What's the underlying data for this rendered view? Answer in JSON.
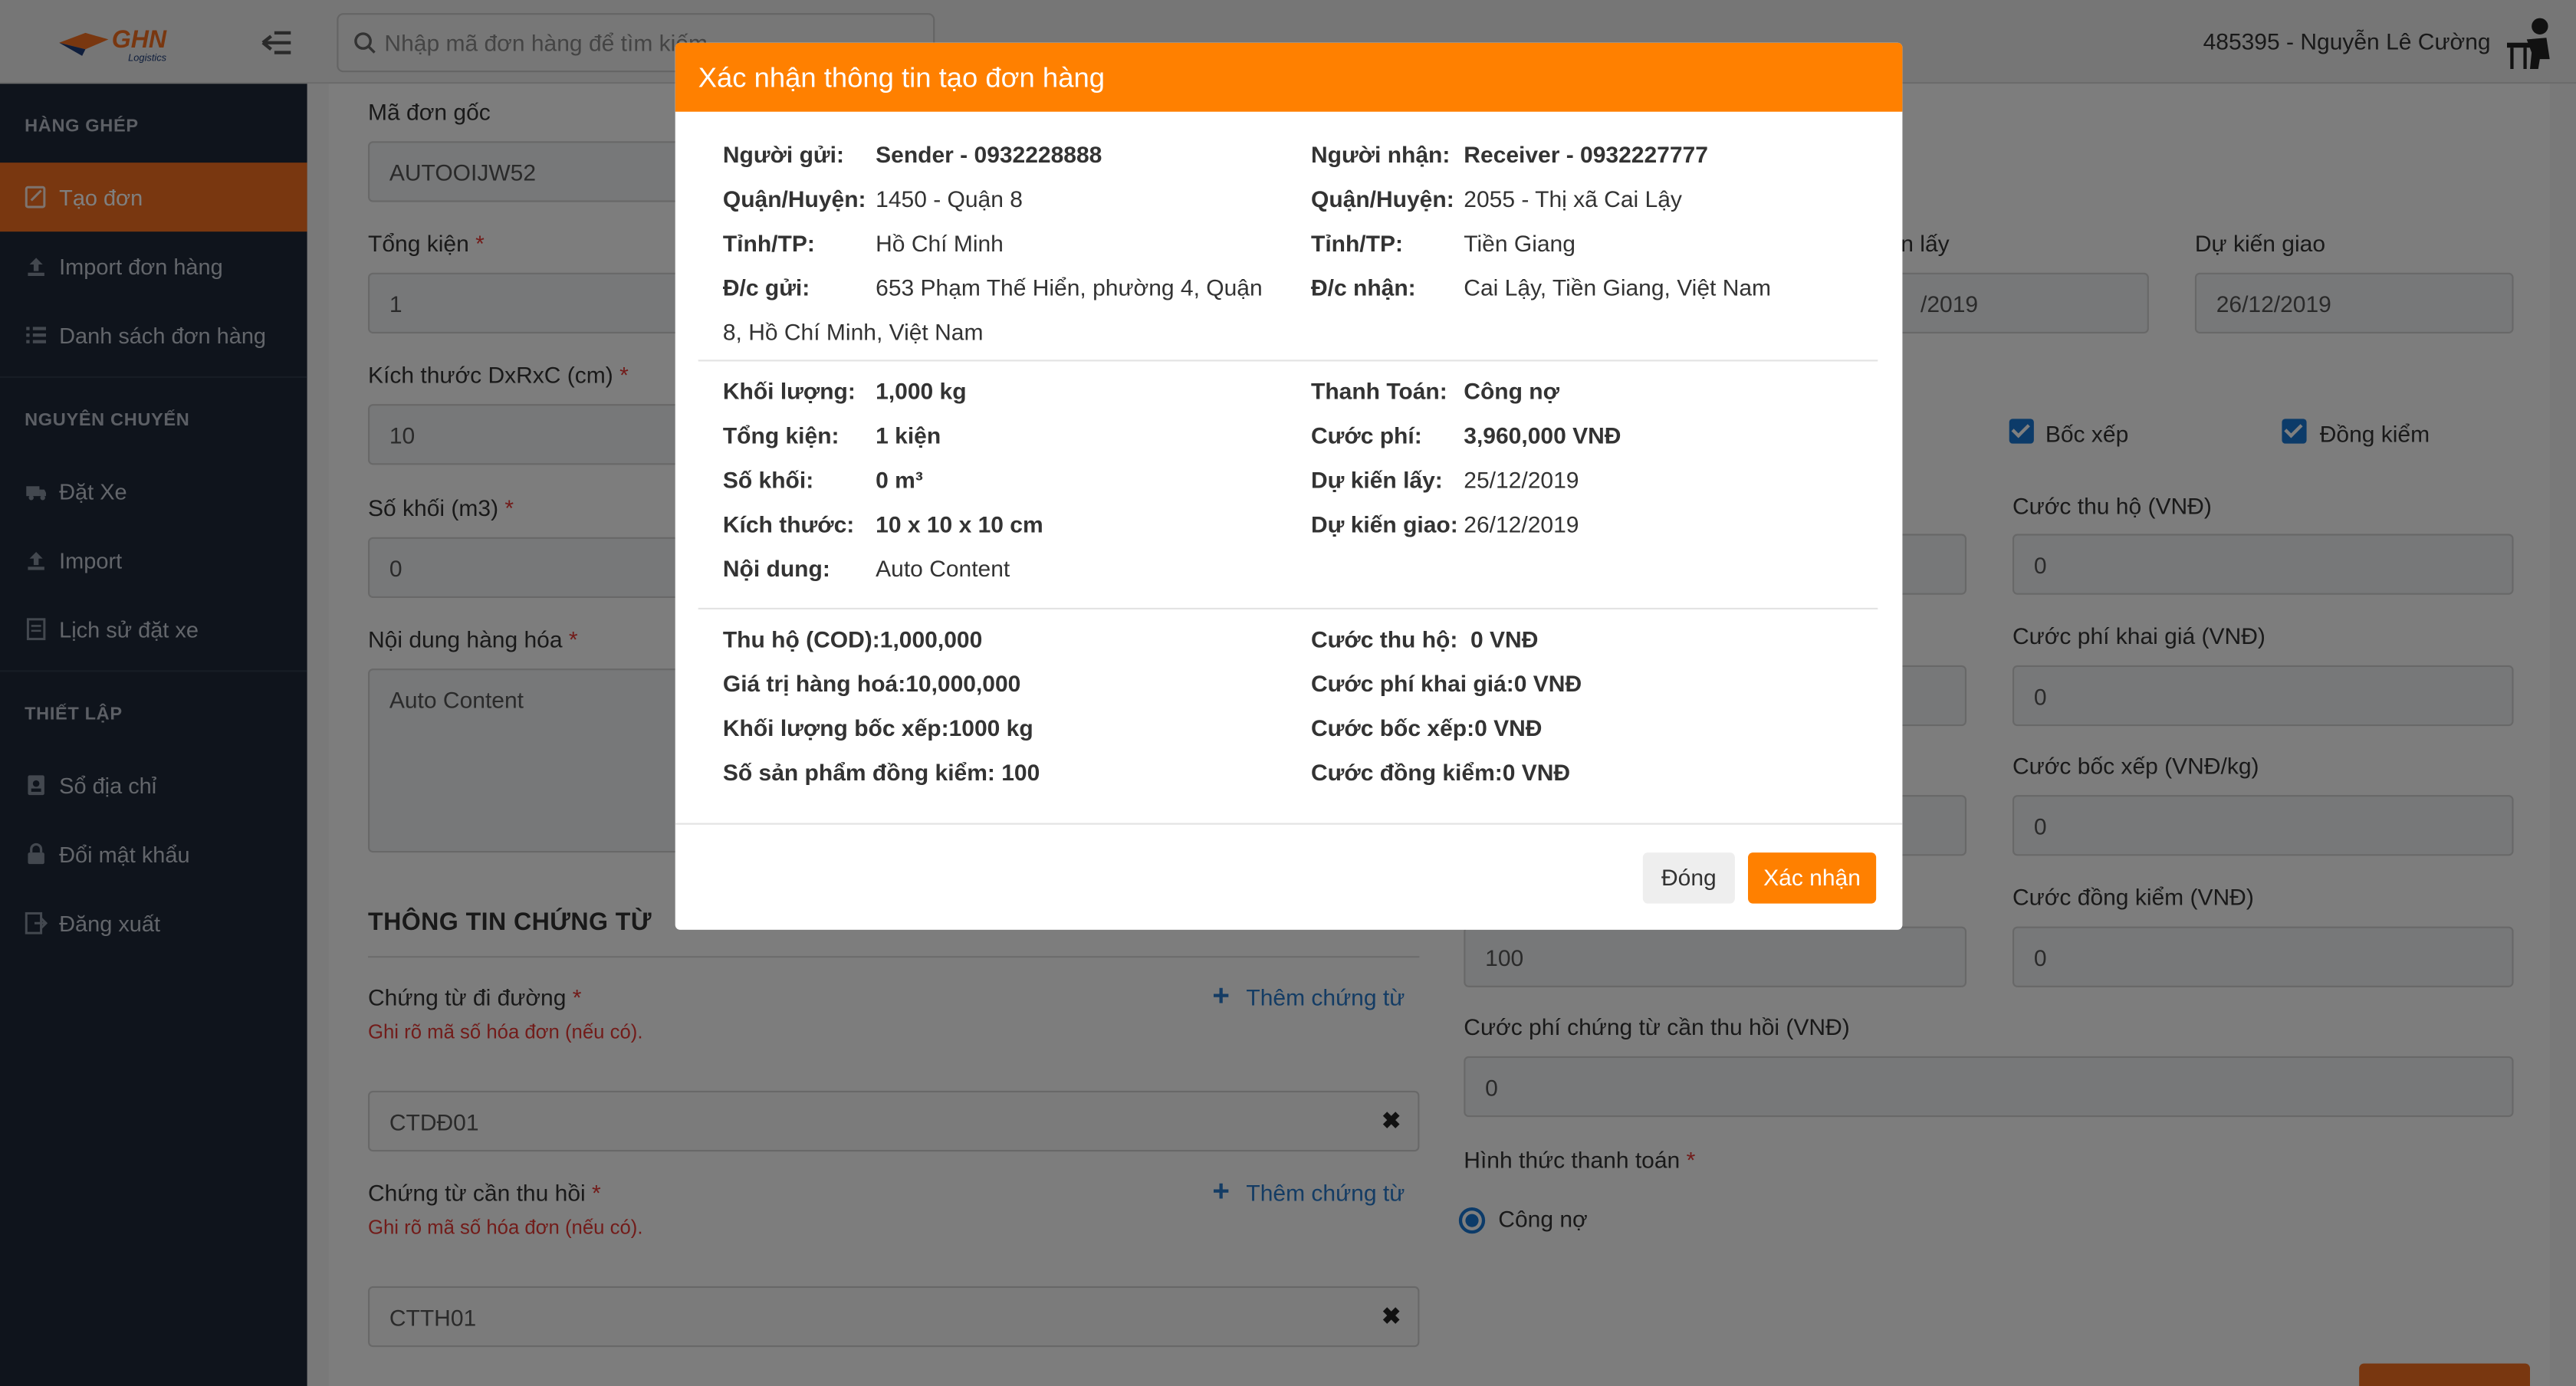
{
  "header": {
    "search_placeholder": "Nhập mã đơn hàng để tìm kiếm",
    "user": "485395 - Nguyễn Lê Cường",
    "logo_text": "GHN Logistics"
  },
  "sidebar": {
    "section1": "HÀNG GHÉP",
    "items1": [
      "Tạo đơn",
      "Import đơn hàng",
      "Danh sách đơn hàng"
    ],
    "section2": "NGUYÊN CHUYẾN",
    "items2": [
      "Đặt Xe",
      "Import",
      "Lịch sử đặt xe"
    ],
    "section3": "THIẾT LẬP",
    "items3": [
      "Sổ địa chỉ",
      "Đổi mật khẩu",
      "Đăng xuất"
    ]
  },
  "form": {
    "ma_don_goc_label": "Mã đơn gốc",
    "ma_don_goc_value": "AUTOOIJW52",
    "tong_kien_label": "Tổng kiện",
    "tong_kien_value": "1",
    "kich_thuoc_label": "Kích thước DxRxC (cm)",
    "kich_thuoc_value": "10",
    "so_khoi_label": "Số khối (m3)",
    "so_khoi_value": "0",
    "noi_dung_label": "Nội dung hàng hóa",
    "noi_dung_value": "Auto Content",
    "du_kien_lay_label": "n lấy",
    "du_kien_lay_value": "/2019",
    "du_kien_giao_label": "Dự kiến giao",
    "du_kien_giao_value": "26/12/2019",
    "boc_xep": "Bốc xếp",
    "dong_kiem": "Đồng kiểm",
    "cuoc_thu_ho_label": "Cước thu hộ (VNĐ)",
    "cuoc_thu_ho_value": "0",
    "cuoc_khai_gia_label": "Cước phí khai giá (VNĐ)",
    "cuoc_khai_gia_value": "0",
    "cuoc_boc_xep_label": "Cước bốc xếp (VNĐ/kg)",
    "cuoc_boc_xep_value": "0",
    "cuoc_dong_kiem_label": "Cước đồng kiểm (VNĐ)",
    "cuoc_dong_kiem_value": "0",
    "dong_kiem_qty_value": "100",
    "cuoc_chung_tu_label": "Cước phí chứng từ cần thu hồi (VNĐ)",
    "cuoc_chung_tu_value": "0",
    "hinh_thuc_label": "Hình thức thanh toán",
    "hinh_thuc_value": "Công nợ",
    "thong_tin_chung_tu": "THÔNG TIN CHỨNG TỪ",
    "chung_tu_di_duong_label": "Chứng từ đi đường",
    "chung_tu_di_duong_hint": "Ghi rõ mã số hóa đơn (nếu có).",
    "chung_tu_di_duong_value": "CTDĐ01",
    "chung_tu_thu_hoi_label": "Chứng từ cần thu hồi",
    "chung_tu_thu_hoi_hint": "Ghi rõ mã số hóa đơn (nếu có).",
    "chung_tu_thu_hoi_value": "CTTH01",
    "them_chung_tu": "Thêm chứng từ",
    "required_mark": "*",
    "remove_mark": "✖",
    "add_mark": "+"
  },
  "modal": {
    "title": "Xác nhận thông tin tạo đơn hàng",
    "nguoi_gui_k": "Người gửi:",
    "nguoi_gui_v": "Sender - 0932228888",
    "quan_gui_k": "Quận/Huyện:",
    "quan_gui_v": "1450 - Quận 8",
    "tinh_gui_k": "Tỉnh/TP:",
    "tinh_gui_v": "Hồ Chí Minh",
    "dc_gui_k": "Đ/c gửi:",
    "dc_gui_v1": "653 Phạm Thế Hiển, phường 4, Quận",
    "dc_gui_v2": "8, Hồ Chí Minh, Việt Nam",
    "nguoi_nhan_k": "Người nhận:",
    "nguoi_nhan_v": "Receiver - 0932227777",
    "quan_nhan_k": "Quận/Huyện:",
    "quan_nhan_v": "2055 - Thị xã Cai Lậy",
    "tinh_nhan_k": "Tỉnh/TP:",
    "tinh_nhan_v": "Tiền Giang",
    "dc_nhan_k": "Đ/c nhận:",
    "dc_nhan_v": "Cai Lậy, Tiền Giang, Việt Nam",
    "khoi_luong_k": "Khối lượng:",
    "khoi_luong_v": "1,000 kg",
    "tong_kien_k": "Tổng kiện:",
    "tong_kien_v": "1 kiện",
    "so_khoi_k": "Số khối:",
    "so_khoi_v": "0 m³",
    "kich_thuoc_k": "Kích thước:",
    "kich_thuoc_v": "10 x 10 x 10 cm",
    "noi_dung_k": "Nội dung:",
    "noi_dung_v": "Auto Content",
    "thanh_toan_k": "Thanh Toán:",
    "thanh_toan_v": "Công nợ",
    "cuoc_phi_k": "Cước phí:",
    "cuoc_phi_v": "3,960,000 VNĐ",
    "du_kien_lay_k": "Dự kiến lấy:",
    "du_kien_lay_v": "25/12/2019",
    "du_kien_giao_k": "Dự kiến giao:",
    "du_kien_giao_v": "26/12/2019",
    "thu_ho": "Thu hộ (COD):1,000,000",
    "gia_tri": "Giá trị hàng hoá:10,000,000",
    "kl_boc_xep": "Khối lượng bốc xếp:1000 kg",
    "sp_dong_kiem": "Số sản phẩm đồng kiểm: 100",
    "cuoc_thu_ho": "Cước thu hộ:  0 VNĐ",
    "cuoc_khai_gia": "Cước phí khai giá:0 VNĐ",
    "cuoc_boc_xep": "Cước bốc xếp:0 VNĐ",
    "cuoc_dong_kiem": "Cước đồng kiểm:0 VNĐ",
    "btn_close": "Đóng",
    "btn_ok": "Xác nhận"
  },
  "colors": {
    "accent": "#ff8000",
    "sidebar": "#1e2838",
    "link": "#2979c9"
  }
}
